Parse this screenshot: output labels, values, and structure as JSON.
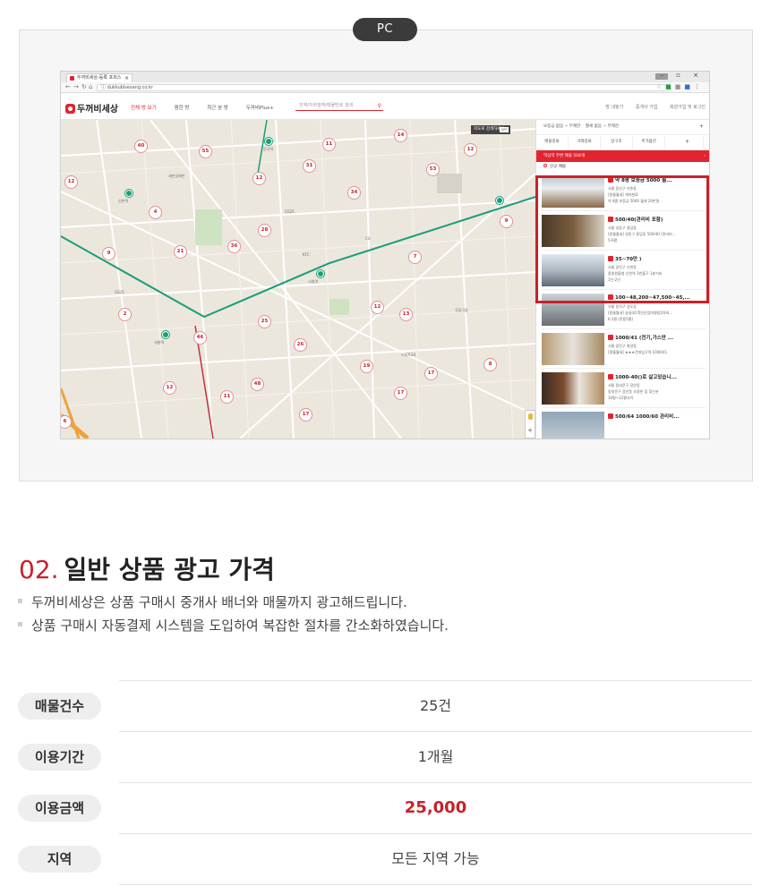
{
  "badge": "PC",
  "browser": {
    "tab_title": "두꺼비세상-등록 포피스",
    "tab_close": "×",
    "window_controls": "–  ▫  ×",
    "url": "ⓘ dukkubisesang.co.kr"
  },
  "site": {
    "logo": "두꺼비세상",
    "nav": [
      "전체 방 보기",
      "찜한 방",
      "최근 본 방",
      "두꺼비Plus+"
    ],
    "search_placeholder": "지역/지하철역/매물번호 검색",
    "utils": [
      "방 내놓기",
      "중개사 가입",
      "회원가입 및 로그인"
    ]
  },
  "map": {
    "toggle_label": "지도로 검색하세요",
    "toggle_state": "OFF",
    "clusters": [
      "40",
      "55",
      "31",
      "14",
      "53",
      "12",
      "11",
      "12",
      "34",
      "4",
      "28",
      "36",
      "21",
      "9",
      "7",
      "9",
      "12",
      "12",
      "2",
      "25",
      "26",
      "46",
      "13",
      "19",
      "17",
      "48",
      "11",
      "17",
      "8",
      "12",
      "6",
      "17",
      "5"
    ],
    "labels": [
      "안국역",
      "신촌역",
      "을지로입구역",
      "서울역",
      "시청역",
      "역삼역",
      "숭례문",
      "CU",
      "GS25",
      "세븐일레븐",
      "이마트24",
      "KFC",
      "국립극장"
    ]
  },
  "sidebar": {
    "filter1": [
      "보증금  없음 ~ 무제한",
      "월세  없음 ~ 무제한"
    ],
    "filter2": [
      "매물종류",
      "거래종류",
      "방구조",
      "추가옵션"
    ],
    "nearby": "역삼역 주변 매물 504개",
    "new_label": "신규 매물",
    "items": [
      {
        "title": "약 8평 보증금 5000 월...",
        "line1": "서울 용산구 이촌동",
        "line2": "[원룸월세] 계약완료",
        "line3": "약 8평 보증금 5000 월세 20만원"
      },
      {
        "title": "500/40(관리비 포함)",
        "line1": "서울 성동구 용답동",
        "line2": "[원룸월세] 성동구 용답동 500/40 (관리비...",
        "line3": "5-6평"
      },
      {
        "title": "35~70만 )",
        "line1": "서울 광진구 신천동",
        "line2": "몸원원룸형 신천역 3번출구 1분거리",
        "line3": "1인-2인"
      },
      {
        "title": "100~48,200~47,500~45,...",
        "line1": "서울 동작구 상도동",
        "line2": "[원룸월세] 숭실대1학년신입대형방2차외...",
        "line3": "6.5평 (전용5평)"
      },
      {
        "title": "1000/41 (전기,가스만 ...",
        "line1": "서울 광진구 화양동",
        "line2": "[원룸월세] ★★★건대입구역 1000/41",
        "line3": ""
      },
      {
        "title": "1000-40()로 살고있습니...",
        "line1": "서울 동대문구 장안동",
        "line2": "동대문구 장안동 조용한 집 찾는분",
        "line3": "10평~12평사이"
      },
      {
        "title": "500/64 1000/60 관리비...",
        "line1": "",
        "line2": "",
        "line3": ""
      }
    ]
  },
  "section": {
    "number": "02.",
    "title": "일반 상품 광고 가격",
    "desc": [
      "두꺼비세상은 상품 구매시 중개사 배너와 매물까지 광고해드립니다.",
      "상품 구매시 자동결제 시스템을 도입하여 복잡한 절차를 간소화하였습니다."
    ]
  },
  "pricing": [
    {
      "label": "매물건수",
      "value": "25건"
    },
    {
      "label": "이용기간",
      "value": "1개월"
    },
    {
      "label": "이용금액",
      "value": "25,000"
    },
    {
      "label": "지역",
      "value": "모든 지역 가능"
    }
  ],
  "colors": {
    "accent": "#c9212a",
    "brand": "#e2242f",
    "subway_line": "#1c9c7a",
    "road": "#f0a23a"
  }
}
